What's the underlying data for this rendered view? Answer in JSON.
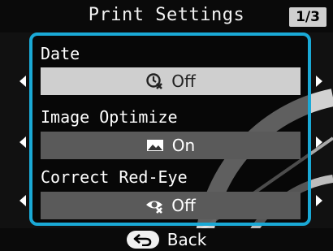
{
  "header": {
    "title": "Print Settings",
    "page_indicator": "1/3"
  },
  "settings": [
    {
      "label": "Date",
      "value": "Off",
      "icon": "date-off-icon",
      "selected": true
    },
    {
      "label": "Image Optimize",
      "value": "On",
      "icon": "image-icon",
      "selected": false
    },
    {
      "label": "Correct Red-Eye",
      "value": "Off",
      "icon": "red-eye-off-icon",
      "selected": false
    }
  ],
  "footer": {
    "back_label": "Back",
    "back_icon": "return-arrow-icon"
  },
  "colors": {
    "accent": "#1aa9d6",
    "selected_value_bg": "#cfcfcf",
    "value_bg": "#5a5a5a"
  }
}
